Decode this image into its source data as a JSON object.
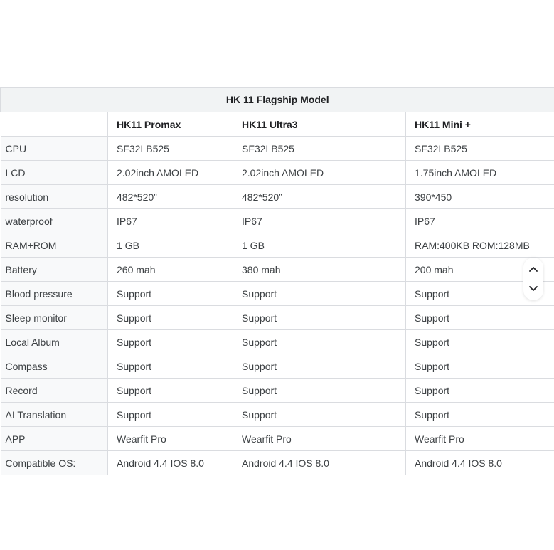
{
  "table": {
    "title": "HK 11  Flagship Model",
    "models": [
      "HK11 Promax",
      "HK11 Ultra3",
      "HK11 Mini +"
    ],
    "rows": [
      {
        "label": "CPU",
        "values": [
          "SF32LB525",
          "SF32LB525",
          "SF32LB525"
        ]
      },
      {
        "label": "LCD",
        "values": [
          "2.02inch AMOLED",
          "2.02inch AMOLED",
          "1.75inch AMOLED"
        ]
      },
      {
        "label": "resolution",
        "values": [
          "482*520”",
          "482*520”",
          "390*450"
        ]
      },
      {
        "label": "waterproof",
        "values": [
          "IP67",
          "IP67",
          "IP67"
        ]
      },
      {
        "label": "RAM+ROM",
        "values": [
          "1 GB",
          "1 GB",
          "RAM:400KB ROM:128MB"
        ]
      },
      {
        "label": "Battery",
        "values": [
          "260 mah",
          "380 mah",
          "200 mah"
        ]
      },
      {
        "label": "Blood pressure",
        "values": [
          "Support",
          "Support",
          "Support"
        ]
      },
      {
        "label": "Sleep monitor",
        "values": [
          "Support",
          "Support",
          "Support"
        ]
      },
      {
        "label": "Local Album",
        "values": [
          "Support",
          "Support",
          "Support"
        ]
      },
      {
        "label": "Compass",
        "values": [
          "Support",
          "Support",
          "Support"
        ]
      },
      {
        "label": "Record",
        "values": [
          "Support",
          "Support",
          "Support"
        ]
      },
      {
        "label": "AI Translation",
        "values": [
          "Support",
          "Support",
          "Support"
        ]
      },
      {
        "label": "APP",
        "values": [
          "Wearfit Pro",
          "Wearfit Pro",
          "Wearfit Pro"
        ]
      },
      {
        "label": "Compatible OS:",
        "values": [
          "Android 4.4 IOS 8.0",
          "Android 4.4 IOS 8.0",
          "Android 4.4 IOS 8.0"
        ]
      }
    ]
  },
  "scroll_controls": {
    "up_icon": "chevron-up-icon",
    "down_icon": "chevron-down-icon"
  },
  "colors": {
    "border": "#dadce0",
    "title_bg": "#f1f3f4",
    "label_bg": "#f8f9fa",
    "text": "#3c4043"
  }
}
